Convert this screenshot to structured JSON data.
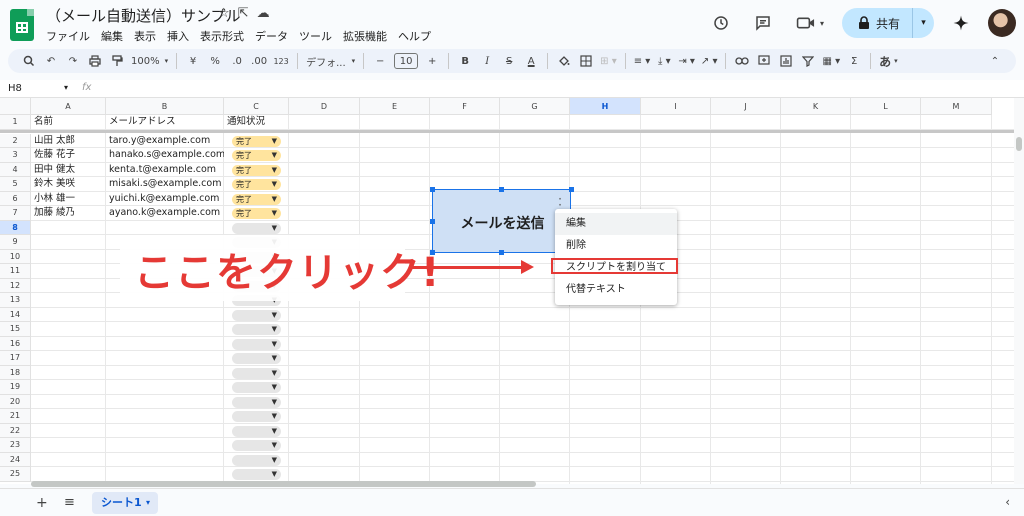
{
  "title_bar": {
    "doc_title": "（メール自動送信）サンプル",
    "star": "☆",
    "move": "⇱",
    "cloud": "☁"
  },
  "menu": [
    "ファイル",
    "編集",
    "表示",
    "挿入",
    "表示形式",
    "データ",
    "ツール",
    "拡張機能",
    "ヘルプ"
  ],
  "header_right": {
    "history_icon": "history-icon",
    "comment_icon": "comment-icon",
    "meet_icon": "video-camera-icon",
    "share_label": "共有",
    "gemini_icon": "sparkle-icon"
  },
  "toolbar": {
    "zoom": "100%",
    "currency": "¥",
    "percent": "%",
    "decrease_decimal": ".0",
    "increase_decimal": ".00",
    "number_format": "123",
    "font": "デフォ...",
    "font_size": "10",
    "bold": "B",
    "italic": "I",
    "strike": "S",
    "text_color": "A",
    "sum": "Σ",
    "input_method": "あ"
  },
  "formula_bar": {
    "name_box": "H8",
    "fx": "fx"
  },
  "columns": [
    "A",
    "B",
    "C",
    "D",
    "E",
    "F",
    "G",
    "H",
    "I",
    "J",
    "K",
    "L",
    "M"
  ],
  "selected_column": "H",
  "selected_row": "8",
  "rows": [
    "1",
    "2",
    "3",
    "4",
    "5",
    "6",
    "7",
    "8",
    "9",
    "10",
    "11",
    "12",
    "13",
    "14",
    "15",
    "16",
    "17",
    "18",
    "19",
    "20",
    "21",
    "22",
    "23",
    "24",
    "25"
  ],
  "table": {
    "headers": [
      "名前",
      "メールアドレス",
      "通知状況"
    ],
    "records": [
      {
        "name": "山田 太郎",
        "email": "taro.y@example.com",
        "status": "完了"
      },
      {
        "name": "佐藤 花子",
        "email": "hanako.s@example.com",
        "status": "完了"
      },
      {
        "name": "田中 健太",
        "email": "kenta.t@example.com",
        "status": "完了"
      },
      {
        "name": "鈴木 美咲",
        "email": "misaki.s@example.com",
        "status": "完了"
      },
      {
        "name": "小林 雄一",
        "email": "yuichi.k@example.com",
        "status": "完了"
      },
      {
        "name": "加藤 綾乃",
        "email": "ayano.k@example.com",
        "status": "完了"
      }
    ]
  },
  "drawing_button": {
    "label": "メールを送信"
  },
  "context_menu": {
    "items": [
      "編集",
      "削除",
      "スクリプトを割り当て",
      "代替テキスト"
    ],
    "highlighted_item": "スクリプトを割り当て"
  },
  "annotation": {
    "text": "ここをクリック!",
    "color": "#e53935"
  },
  "sheet_tabs": {
    "add": "+",
    "all": "≡",
    "active_tab": "シート1"
  },
  "colors": {
    "status_done": "#ffe49e",
    "selection": "#1a73e8",
    "share_button": "#c2e7ff"
  }
}
